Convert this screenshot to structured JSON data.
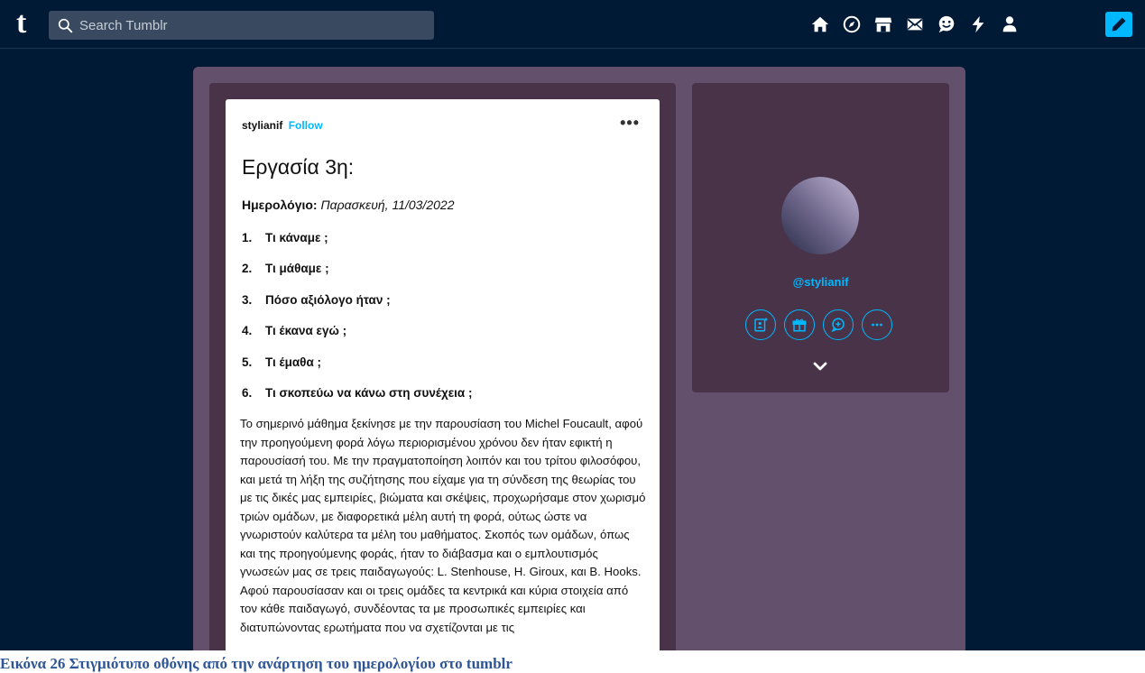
{
  "nav": {
    "logo": "t",
    "search_placeholder": "Search Tumblr",
    "icons": [
      "home-icon",
      "explore-icon",
      "shop-icon",
      "inbox-icon",
      "messages-icon",
      "activity-icon",
      "account-icon"
    ],
    "compose_icon": "pencil-icon",
    "accent": "#00b8ff",
    "background": "#001935"
  },
  "post": {
    "author": "stylianif",
    "follow": "Follow",
    "more": "•••",
    "title": "Εργασία 3η:",
    "diary_label": "Ημερολόγιο:",
    "diary_date": "Παρασκευή, 11/03/2022",
    "questions": [
      {
        "num": "1.",
        "text": "Τι κάναμε ;"
      },
      {
        "num": "2.",
        "text": "Τι μάθαμε ;"
      },
      {
        "num": "3.",
        "text": "Πόσο αξιόλογο ήταν ;"
      },
      {
        "num": "4.",
        "text": "Τι έκανα εγώ ;"
      },
      {
        "num": "5.",
        "text": "Τι έμαθα ;"
      },
      {
        "num": "6.",
        "text": "Τι σκοπεύω να κάνω στη συνέχεια ;"
      }
    ],
    "body": " Το σημερινό μάθημα ξεκίνησε με την παρουσίαση του Michel Foucault, αφού την προηγούμενη φορά λόγω περιορισμένου χρόνου δεν ήταν εφικτή η παρουσίασή του. Με την πραγματοποίηση λοιπόν και του τρίτου φιλοσόφου, και μετά τη λήξη της συζήτησης που είχαμε για τη σύνδεση της θεωρίας του με τις δικές μας εμπειρίες, βιώματα και σκέψεις, προχωρήσαμε στον χωρισμό τριών ομάδων, με διαφορετικά μέλη αυτή τη φορά, ούτως ώστε να γνωριστούν καλύτερα τα μέλη του μαθήματος. Σκοπός των ομάδων, όπως και της προηγούμενης φοράς, ήταν το διάβασμα και ο εμπλουτισμός γνωσεών μας σε τρεις παιδαγωγούς: L. Stenhouse, H. Giroux, και B. Hooks. Αφού παρουσίασαν και οι τρεις ομάδες τα κεντρικά και κύρια στοιχεία από τον κάθε παιδαγωγό, συνδέοντας τα με προσωπικές εμπειρίες και διατυπώνοντας ερωτήματα που να σχετίζονται με τις"
  },
  "sidebar": {
    "handle": "@stylianif",
    "action_icons": [
      "profile-card-icon",
      "gift-icon",
      "chat-plus-icon",
      "more-icon"
    ],
    "expand_icon": "chevron-down-icon"
  },
  "caption": "Εικόνα 26 Στιγμιότυπο οθόνης από την ανάρτηση του ημερολογίου στο tumblr"
}
